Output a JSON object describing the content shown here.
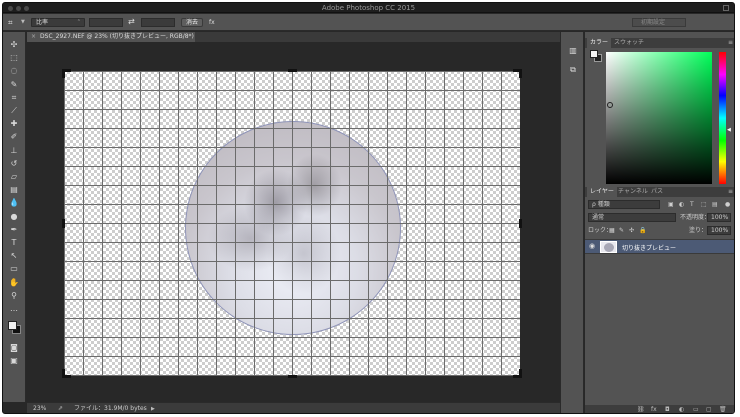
{
  "app": {
    "title": "Adobe Photoshop CC 2015"
  },
  "options_bar": {
    "tool_icon": "crop-icon",
    "ratio_select": "比率",
    "swap_icon": "swap-icon",
    "clear_button": "消去",
    "extra_label": "fx",
    "workspace_select": "初期設定"
  },
  "document": {
    "tab_title": "DSC_2927.NEF @ 23% (切り抜きプレビュー, RGB/8*) *",
    "tab_close": "×"
  },
  "toolbar": {
    "tools": [
      {
        "name": "move-tool",
        "glyph": "✣"
      },
      {
        "name": "marquee-tool",
        "glyph": "⬚"
      },
      {
        "name": "lasso-tool",
        "glyph": "◌"
      },
      {
        "name": "quick-select-tool",
        "glyph": "✎"
      },
      {
        "name": "crop-tool",
        "glyph": "⌗"
      },
      {
        "name": "eyedropper-tool",
        "glyph": "⟋"
      },
      {
        "name": "healing-tool",
        "glyph": "✚"
      },
      {
        "name": "brush-tool",
        "glyph": "✐"
      },
      {
        "name": "stamp-tool",
        "glyph": "⊥"
      },
      {
        "name": "history-brush-tool",
        "glyph": "↺"
      },
      {
        "name": "eraser-tool",
        "glyph": "▱"
      },
      {
        "name": "gradient-tool",
        "glyph": "▤"
      },
      {
        "name": "blur-tool",
        "glyph": "💧"
      },
      {
        "name": "dodge-tool",
        "glyph": "●"
      },
      {
        "name": "pen-tool",
        "glyph": "✒"
      },
      {
        "name": "type-tool",
        "glyph": "T"
      },
      {
        "name": "path-select-tool",
        "glyph": "↖"
      },
      {
        "name": "shape-tool",
        "glyph": "▭"
      },
      {
        "name": "hand-tool",
        "glyph": "✋"
      },
      {
        "name": "zoom-tool",
        "glyph": "⚲"
      },
      {
        "name": "more-tools",
        "glyph": "…"
      }
    ],
    "quickmask_icon": "◙",
    "screenmode_icon": "▣"
  },
  "status_bar": {
    "zoom": "23%",
    "info": "ファイル：31.9M/0 bytes",
    "arrow": "▶"
  },
  "color_panel": {
    "tabs": [
      "カラー",
      "スウォッチ"
    ],
    "fg_color": "#f5f5f5",
    "bg_color": "#222222"
  },
  "layers_panel": {
    "tabs": [
      "レイヤー",
      "チャンネル",
      "パス"
    ],
    "filter": "ρ 種類",
    "blend_mode": "通常",
    "opacity_label": "不透明度：",
    "opacity_value": "100%",
    "lock_label": "ロック：",
    "fill_label": "塗り：",
    "fill_value": "100%",
    "layer_name": "切り抜きプレビュー",
    "menu": "≡"
  },
  "icon_column": {
    "icons": [
      "history-icon",
      "properties-icon"
    ]
  }
}
